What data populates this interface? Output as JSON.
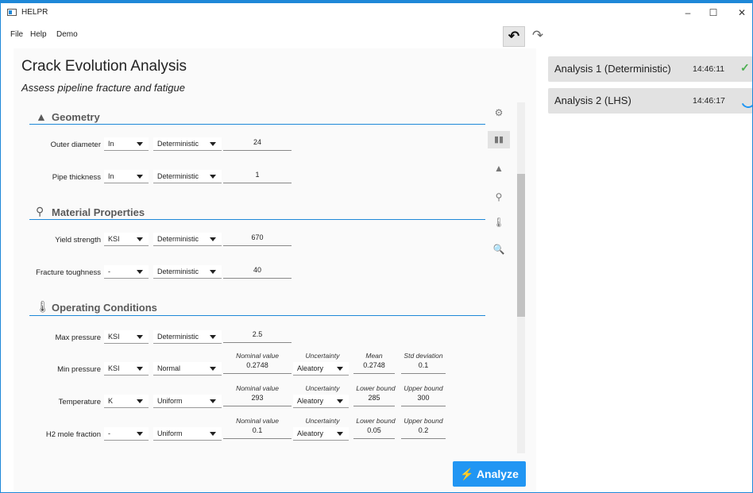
{
  "window": {
    "title": "HELPR"
  },
  "menu": {
    "file": "File",
    "help": "Help",
    "demo": "Demo"
  },
  "toolbar": {
    "undo_icon": "undo-icon",
    "redo_icon": "redo-icon",
    "undo_glyph": "↶",
    "redo_glyph": "↷"
  },
  "page": {
    "title": "Crack Evolution Analysis",
    "subtitle": "Assess pipeline fracture and fatigue"
  },
  "sections": {
    "geometry": "Geometry",
    "material": "Material Properties",
    "operating": "Operating Conditions"
  },
  "rows": {
    "outer_diameter": {
      "label": "Outer diameter",
      "unit": "In",
      "dist": "Deterministic",
      "value": "24"
    },
    "pipe_thickness": {
      "label": "Pipe thickness",
      "unit": "In",
      "dist": "Deterministic",
      "value": "1"
    },
    "yield_strength": {
      "label": "Yield strength",
      "unit": "KSI",
      "dist": "Deterministic",
      "value": "670"
    },
    "fracture_toughness": {
      "label": "Fracture toughness",
      "unit": "-",
      "dist": "Deterministic",
      "value": "40"
    },
    "max_pressure": {
      "label": "Max pressure",
      "unit": "KSI",
      "dist": "Deterministic",
      "value": "2.5"
    },
    "min_pressure": {
      "label": "Min pressure",
      "unit": "KSI",
      "dist": "Normal",
      "nominal_label": "Nominal value",
      "nominal": "0.2748",
      "uncertainty_label": "Uncertainty",
      "uncertainty": "Aleatory",
      "p1_label": "Mean",
      "p1": "0.2748",
      "p2_label": "Std deviation",
      "p2": "0.1"
    },
    "temperature": {
      "label": "Temperature",
      "unit": "K",
      "dist": "Uniform",
      "nominal_label": "Nominal value",
      "nominal": "293",
      "uncertainty_label": "Uncertainty",
      "uncertainty": "Aleatory",
      "p1_label": "Lower bound",
      "p1": "285",
      "p2_label": "Upper bound",
      "p2": "300"
    },
    "h2_mole_fraction": {
      "label": "H2 mole fraction",
      "unit": "-",
      "dist": "Uniform",
      "nominal_label": "Nominal value",
      "nominal": "0.1",
      "uncertainty_label": "Uncertainty",
      "uncertainty": "Aleatory",
      "p1_label": "Lower bound",
      "p1": "0.05",
      "p2_label": "Upper bound",
      "p2": "0.2"
    }
  },
  "analyze_button": "⚡ Analyze",
  "analyses": [
    {
      "name": "Analysis 1 (Deterministic)",
      "time": "14:46:11",
      "status": "complete"
    },
    {
      "name": "Analysis 2 (LHS)",
      "time": "14:46:17",
      "status": "running"
    }
  ],
  "colors": {
    "accent": "#2196f3",
    "success": "#4caf50"
  }
}
